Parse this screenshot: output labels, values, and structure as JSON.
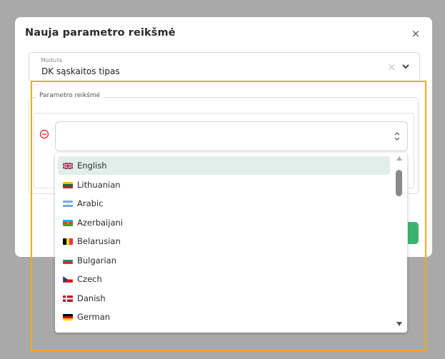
{
  "modal": {
    "title": "Nauja parametro reikšmė",
    "close_glyph": "×",
    "modulis": {
      "label": "Modulis",
      "value": "DK sąskaitos tipas",
      "clear_glyph": "×"
    },
    "parametro_legend": "Parametro reikšmė",
    "language_select": {
      "value": ""
    }
  },
  "dropdown": {
    "options": [
      {
        "label": "English",
        "flag": "flag-uk-icon",
        "selected": true
      },
      {
        "label": "Lithuanian",
        "flag": "flag-lithuania-icon",
        "selected": false
      },
      {
        "label": "Arabic",
        "flag": "flag-arabic-icon",
        "selected": false
      },
      {
        "label": "Azerbaijani",
        "flag": "flag-azerbaijan-icon",
        "selected": false
      },
      {
        "label": "Belarusian",
        "flag": "flag-belarus-icon",
        "selected": false
      },
      {
        "label": "Bulgarian",
        "flag": "flag-bulgaria-icon",
        "selected": false
      },
      {
        "label": "Czech",
        "flag": "flag-czech-icon",
        "selected": false
      },
      {
        "label": "Danish",
        "flag": "flag-denmark-icon",
        "selected": false
      },
      {
        "label": "German",
        "flag": "flag-germany-icon",
        "selected": false
      }
    ]
  },
  "colors": {
    "highlight": "#f5a91a",
    "selected_option": "#e1efea",
    "remove_icon": "#d9363e",
    "primary_button": "#3cb371",
    "overlay": "#a9a9a9"
  }
}
